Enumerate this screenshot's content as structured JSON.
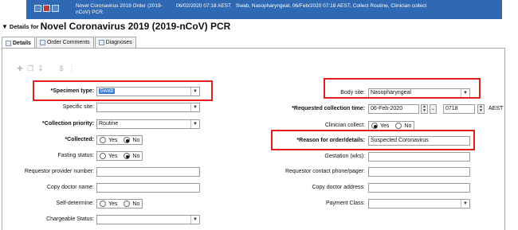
{
  "order_bar": {
    "order_name": "Novel Coronavirus 2019 Order (2019-nCoV) PCR",
    "order_date": "06/02/2020 07:18 AEST",
    "order_detail": "Swab, Nasopharyngeal, 06/Feb/2020 07:18 AEST, Collect Routine, Clinician collect"
  },
  "header": {
    "prefix": "Details for",
    "title": "Novel Coronavirus 2019 (2019-nCoV) PCR"
  },
  "tabs": [
    {
      "label": "Details",
      "active": true
    },
    {
      "label": "Order Comments",
      "active": false
    },
    {
      "label": "Diagnoses",
      "active": false
    }
  ],
  "left_fields": {
    "specimen_type": {
      "label": "*Specimen type:",
      "value": "Swab"
    },
    "specific_site": {
      "label": "Specific site:",
      "value": ""
    },
    "collection_priority": {
      "label": "*Collection priority:",
      "value": "Routine"
    },
    "collected": {
      "label": "*Collected:",
      "options": [
        "Yes",
        "No"
      ],
      "selected": "No"
    },
    "fasting_status": {
      "label": "Fasting status:",
      "options": [
        "Yes",
        "No"
      ],
      "selected": "No"
    },
    "requestor_provider_number": {
      "label": "Requestor provider number:",
      "value": ""
    },
    "copy_doctor_name": {
      "label": "Copy doctor name:",
      "value": ""
    },
    "self_determine": {
      "label": "Self-determine:",
      "options": [
        "Yes",
        "No"
      ],
      "selected": ""
    },
    "chargeable_status": {
      "label": "Chargeable Status:",
      "value": ""
    }
  },
  "right_fields": {
    "body_site": {
      "label": "Body site:",
      "value": "Nasopharyngeal"
    },
    "requested_collection_time": {
      "label": "*Requested collection time:",
      "date": "06-Feb-2020",
      "time": "0718",
      "zone": "AEST"
    },
    "clinician_collect": {
      "label": "Clinician collect:",
      "options": [
        "Yes",
        "No"
      ],
      "selected": "Yes"
    },
    "reason_for_order": {
      "label": "*Reason for order/details:",
      "value": "Suspected Coronavirus"
    },
    "gestation": {
      "label": "Gestation (wks):",
      "value": ""
    },
    "requestor_contact": {
      "label": "Requestor contact phone/pager:",
      "value": ""
    },
    "copy_doctor_address": {
      "label": "Copy doctor address:",
      "value": ""
    },
    "payment_class": {
      "label": "Payment Class:",
      "value": ""
    }
  },
  "colors": {
    "accent": "#2f69b3",
    "highlight": "#e02020",
    "selection": "#3577d2"
  }
}
